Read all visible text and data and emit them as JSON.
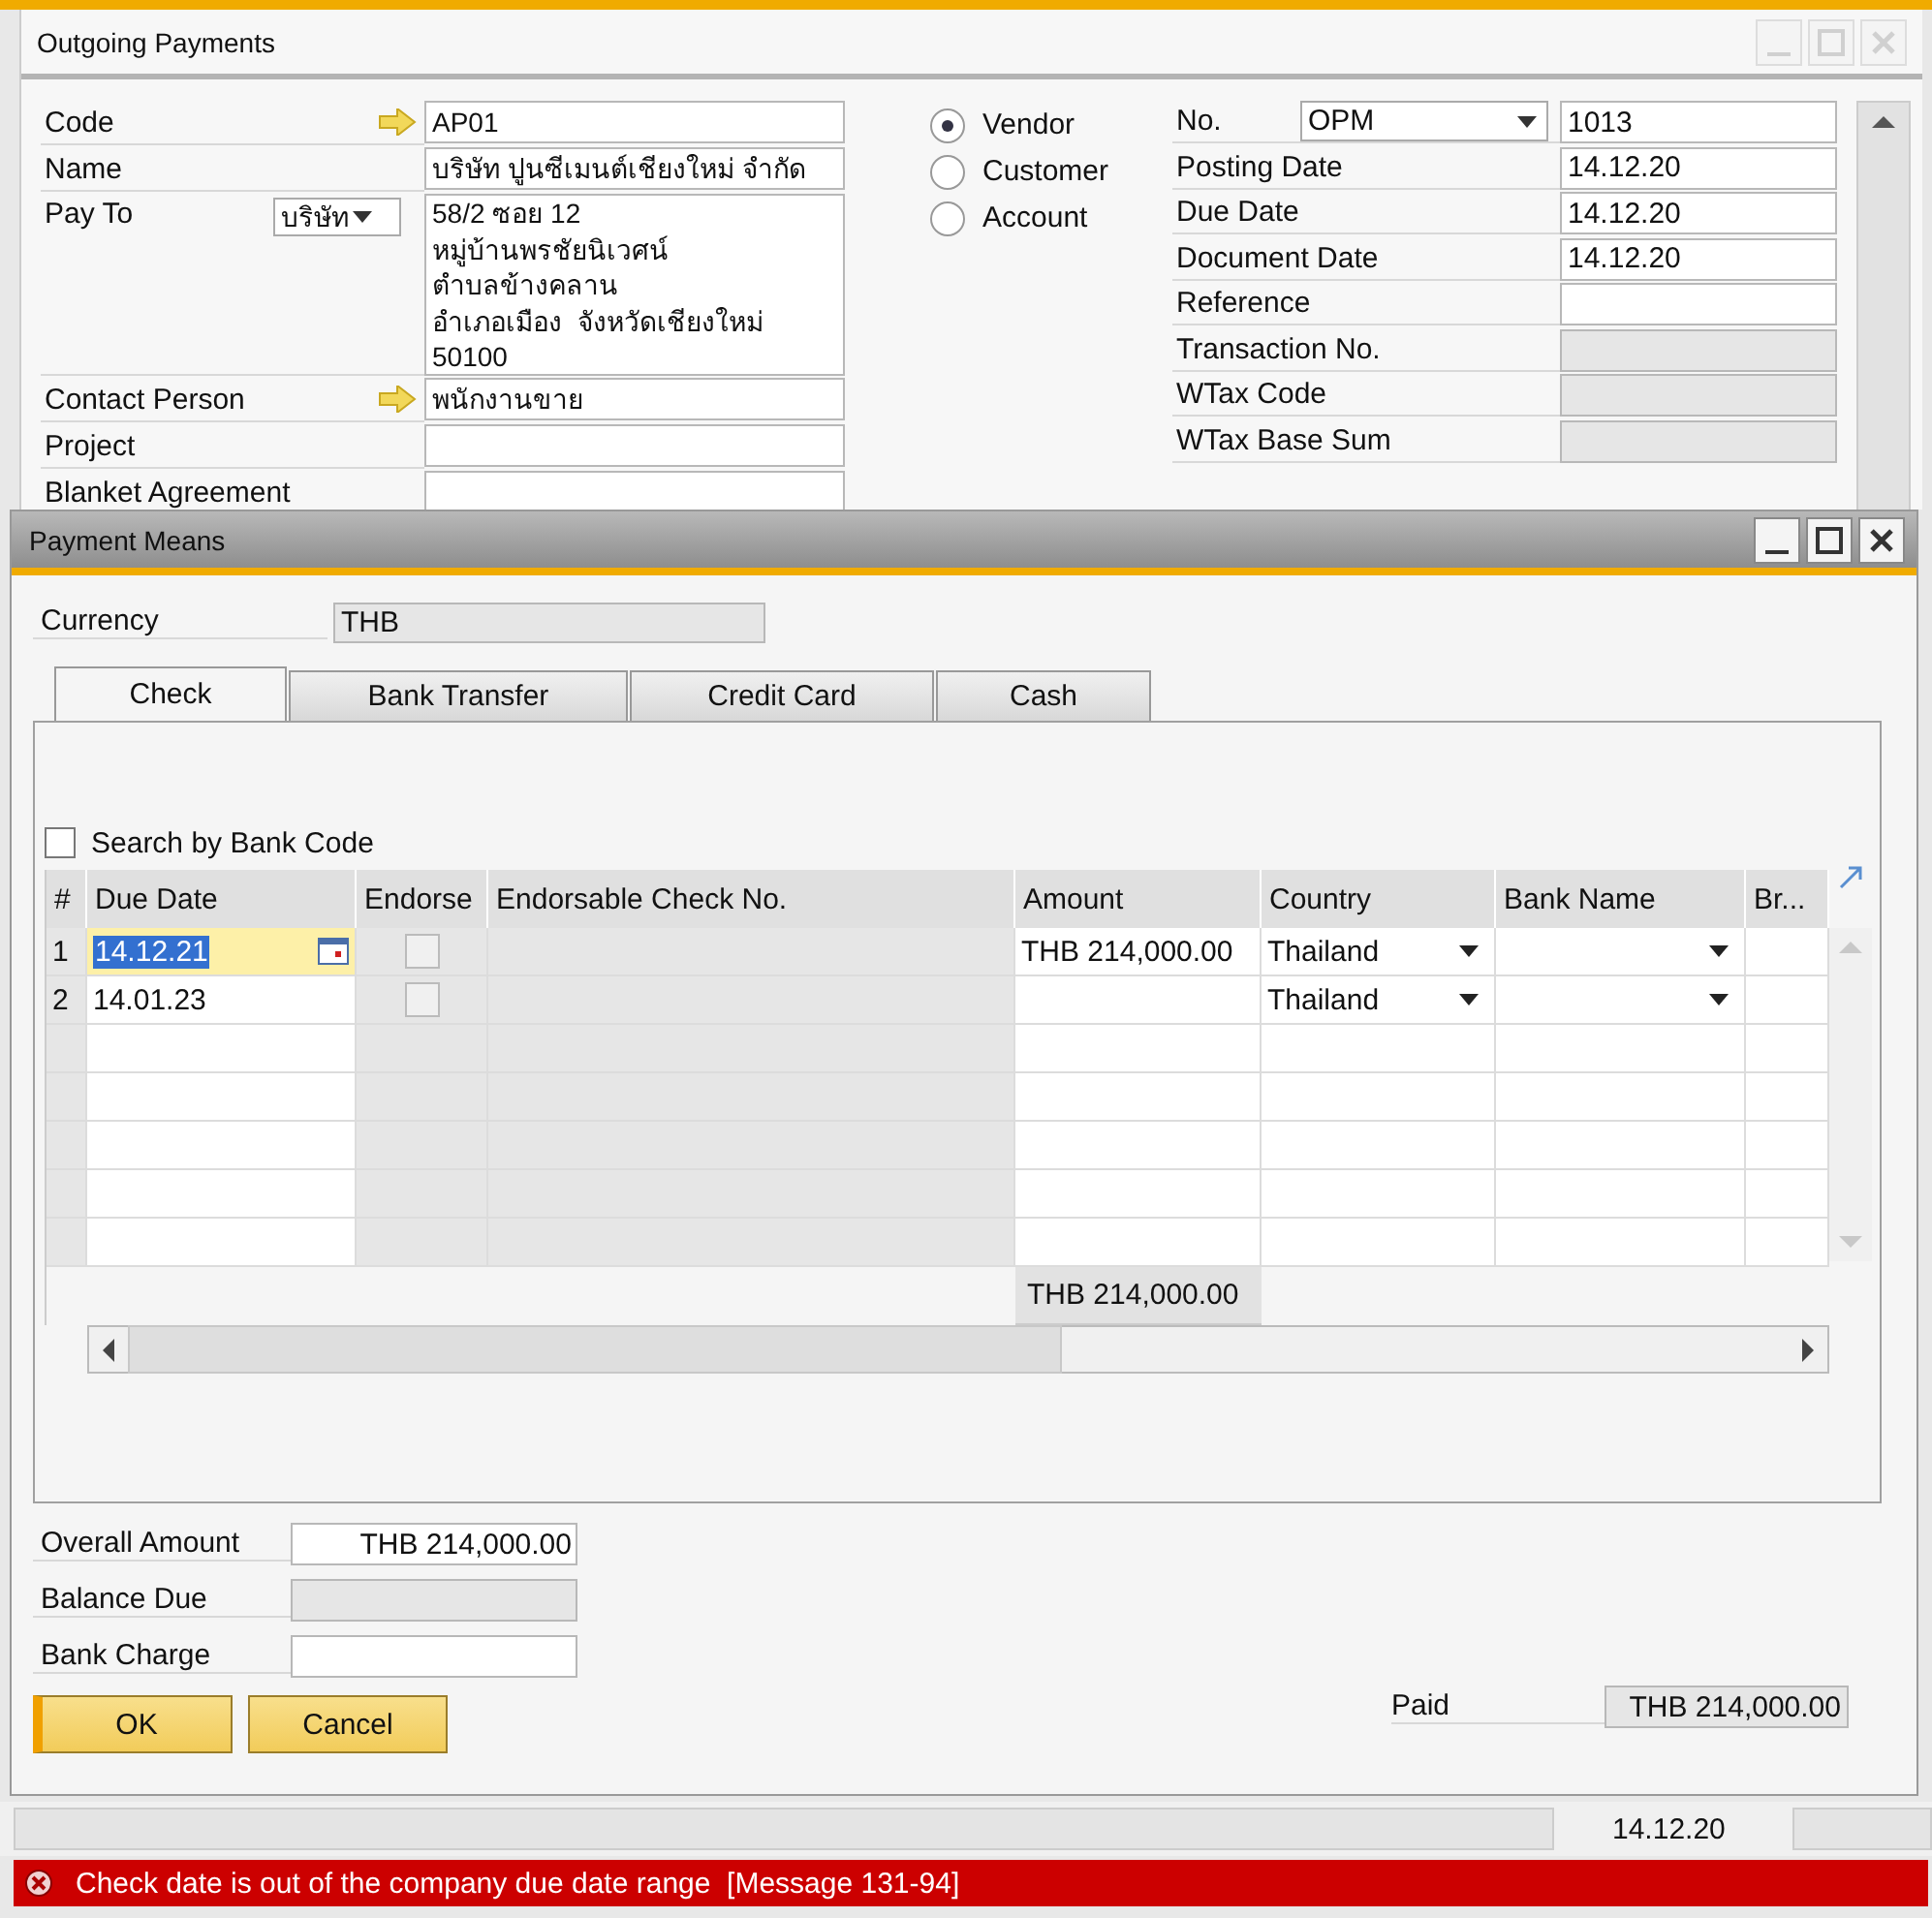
{
  "outer_window": {
    "title": "Outgoing Payments",
    "left_fields": [
      {
        "kind": "text",
        "label": "Code",
        "value": "AP01",
        "link_arrow": true
      },
      {
        "kind": "text",
        "label": "Name",
        "value": "บริษัท ปูนซีเมนต์เชียงใหม่ จำกัด",
        "link_arrow": false
      },
      {
        "kind": "address",
        "label": "Pay To",
        "select": "บริษัท",
        "lines": [
          "58/2 ซอย 12",
          "หมู่บ้านพรชัยนิเวศน์",
          "ตำบลข้างคลาน",
          "อำเภอเมือง  จังหวัดเชียงใหม่",
          "50100"
        ]
      },
      {
        "kind": "text",
        "label": "Contact Person",
        "value": "พนักงานขาย",
        "link_arrow": true
      },
      {
        "kind": "text",
        "label": "Project",
        "link_arrow": false
      },
      {
        "kind": "text",
        "label": "Blanket Agreement",
        "link_arrow": false
      }
    ],
    "bp_types": [
      {
        "label": "Vendor",
        "selected": true
      },
      {
        "label": "Customer",
        "selected": false
      },
      {
        "label": "Account",
        "selected": false
      }
    ],
    "right_fields": [
      {
        "label": "No.",
        "series": "OPM",
        "value": "1013",
        "disabled": false
      },
      {
        "label": "Posting Date",
        "value": "14.12.20",
        "disabled": false
      },
      {
        "label": "Due Date",
        "value": "14.12.20",
        "disabled": false
      },
      {
        "label": "Document Date",
        "value": "14.12.20",
        "disabled": false
      },
      {
        "label": "Reference",
        "disabled": false
      },
      {
        "label": "Transaction No.",
        "disabled": true
      },
      {
        "label": "WTax Code",
        "disabled": true
      },
      {
        "label": "WTax Base Sum",
        "disabled": true
      }
    ]
  },
  "payment_means": {
    "title": "Payment Means",
    "currency": {
      "label": "Currency",
      "value": "THB"
    },
    "tabs": [
      {
        "label": "Check",
        "selected": true
      },
      {
        "label": "Bank Transfer",
        "selected": false
      },
      {
        "label": "Credit Card",
        "selected": false
      },
      {
        "label": "Cash",
        "selected": false
      }
    ],
    "search_by_bank_code": {
      "label": "Search by Bank Code",
      "checked": false
    },
    "table": {
      "columns": [
        "#",
        "Due Date",
        "Endorse",
        "Endorsable Check No.",
        "Amount",
        "Country",
        "Bank Name",
        "Br..."
      ],
      "rows": [
        {
          "number": "1",
          "due_date": "14.12.21",
          "endorse": false,
          "amount": "THB 214,000.00",
          "country": "Thailand",
          "selected": true
        },
        {
          "number": "2",
          "due_date": "14.01.23",
          "endorse": false,
          "country": "Thailand",
          "selected": false
        }
      ],
      "total_amount": "THB 214,000.00"
    },
    "summary": [
      {
        "label": "Overall Amount",
        "value": "THB 214,000.00",
        "disabled": false
      },
      {
        "label": "Balance Due",
        "disabled": true
      },
      {
        "label": "Bank Charge",
        "disabled": false
      }
    ],
    "buttons": [
      {
        "label": "OK",
        "default": true
      },
      {
        "label": "Cancel",
        "default": false
      }
    ],
    "paid": {
      "label": "Paid",
      "value": "THB 214,000.00"
    }
  },
  "status_bar": {
    "date": "14.12.20",
    "message": "Check date is out of the company due date range  [Message 131-94]"
  }
}
